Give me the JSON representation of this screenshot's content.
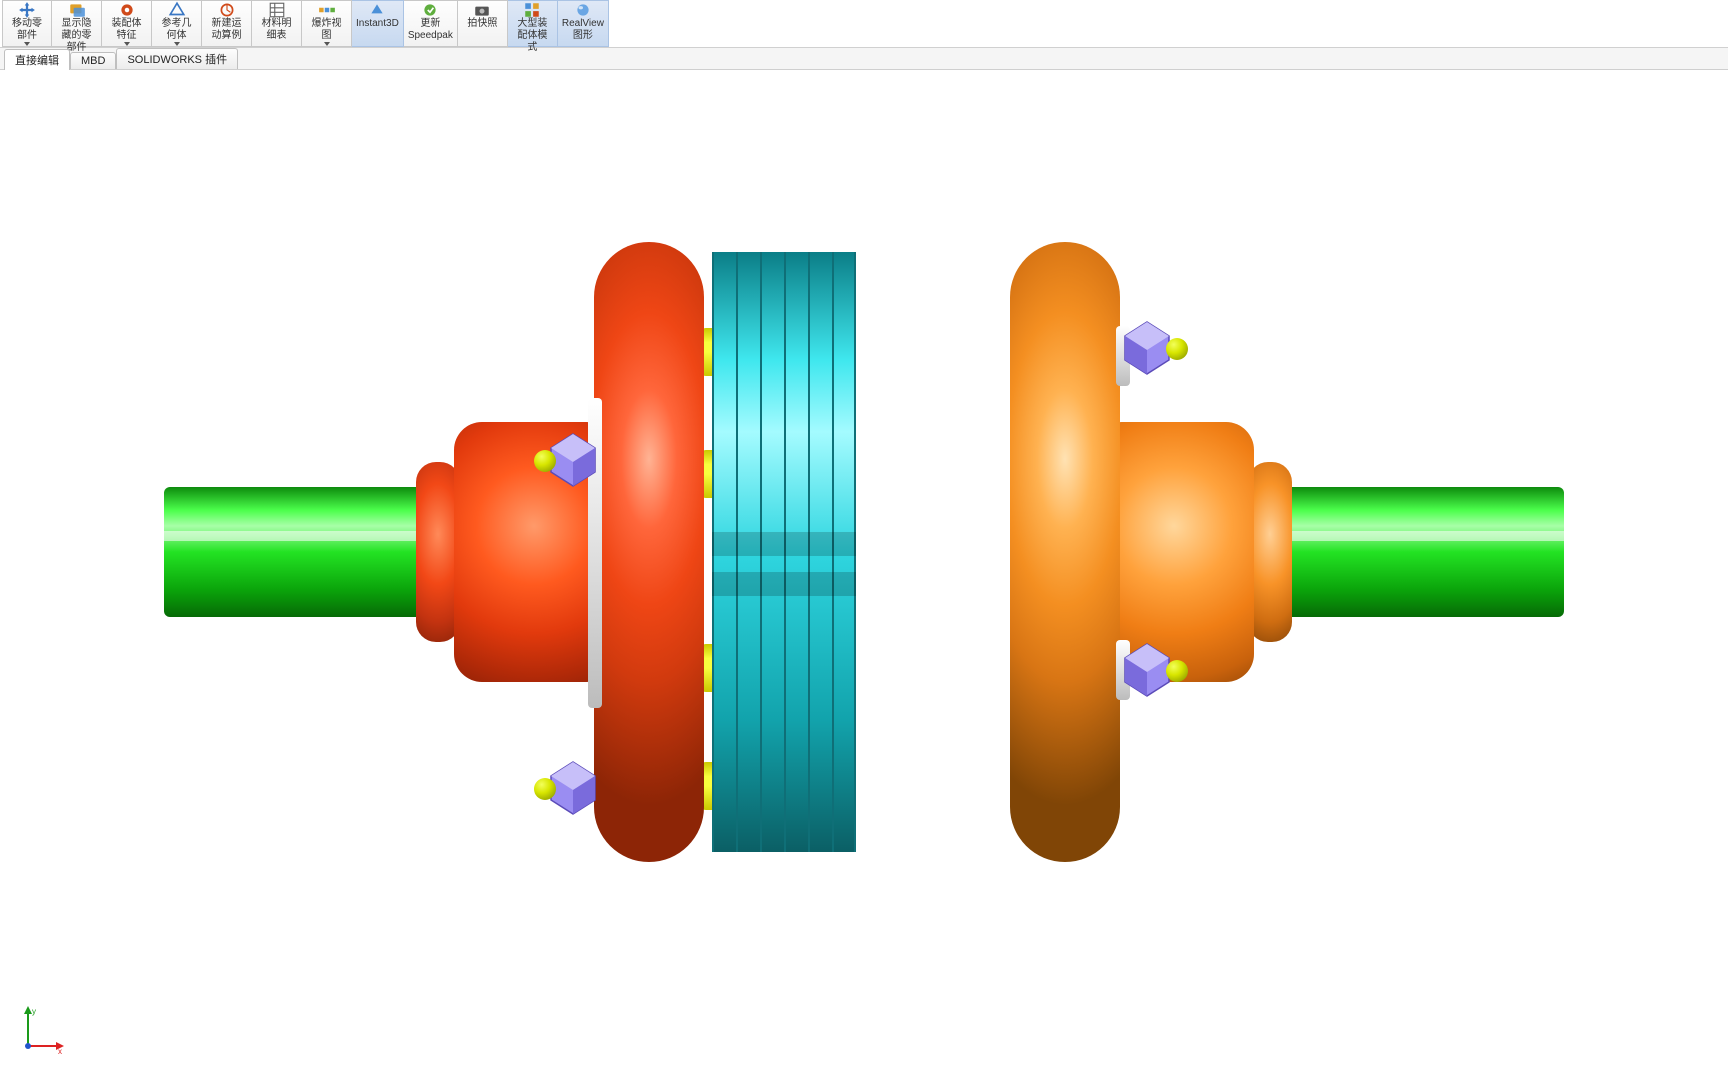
{
  "ribbon": {
    "buttons": [
      {
        "label_line1": "移动零",
        "label_line2": "部件",
        "caret": true
      },
      {
        "label_line1": "显示隐",
        "label_line2": "藏的零",
        "label_line3": "部件",
        "caret": true
      },
      {
        "label_line1": "装配体",
        "label_line2": "特征",
        "caret": true
      },
      {
        "label_line1": "参考几",
        "label_line2": "何体",
        "caret": true
      },
      {
        "label_line1": "新建运",
        "label_line2": "动算例"
      },
      {
        "label_line1": "材料明",
        "label_line2": "细表"
      },
      {
        "label_line1": "爆炸视",
        "label_line2": "图",
        "caret": true
      },
      {
        "label_line1": "Instant3D",
        "active": true
      },
      {
        "label_line1": "更新",
        "label_line2": "Speedpak"
      },
      {
        "label_line1": "拍快照"
      },
      {
        "label_line1": "大型装",
        "label_line2": "配体模",
        "label_line3": "式",
        "active": true
      },
      {
        "label_line1": "RealView",
        "label_line2": "图形",
        "active": true
      }
    ]
  },
  "tabs": {
    "items": [
      {
        "label": "直接编辑",
        "active": true
      },
      {
        "label": "MBD"
      },
      {
        "label": "SOLIDWORKS 插件"
      }
    ]
  },
  "hud_icons": [
    "orbit-icon",
    "zoom-fit-icon",
    "zoom-window-icon",
    "prev-view-icon",
    "section-icon",
    "display-style-icon",
    "hlr-icon",
    "shaded-edges-icon",
    "shaded-icon",
    "sep",
    "cube-icon",
    "sep",
    "eye-icon",
    "sep",
    "appearance-icon",
    "scene-icon",
    "sep",
    "monitor-icon"
  ],
  "triad_axes": {
    "x": "x",
    "y": "y"
  },
  "model": {
    "name": "disc-coupling-assembly",
    "disc_count": 6
  }
}
